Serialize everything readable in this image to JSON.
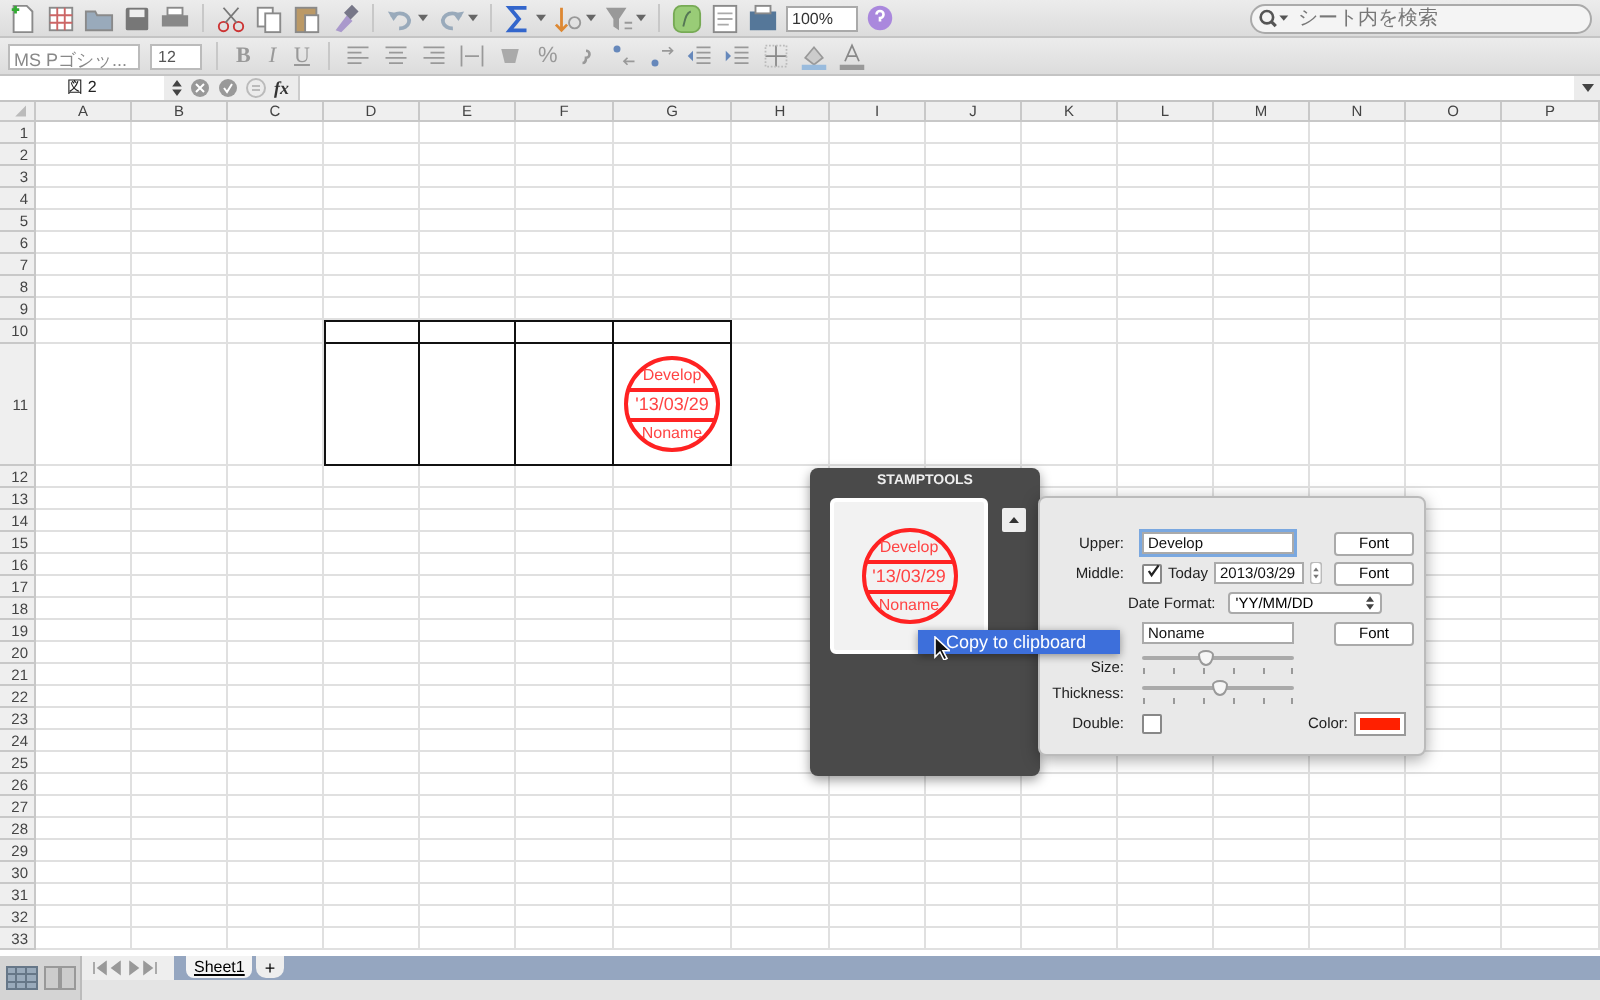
{
  "toolbar": {
    "zoom": "100%",
    "search_placeholder": "シート内を検索"
  },
  "format_bar": {
    "font": "MS Pゴシッ...",
    "size": "12",
    "style_buttons": [
      "B",
      "I",
      "U"
    ],
    "percent": "%"
  },
  "formula_bar": {
    "name_box": "図 2",
    "fx": "fx"
  },
  "sheet": {
    "columns": [
      "A",
      "B",
      "C",
      "D",
      "E",
      "F",
      "G",
      "H",
      "I",
      "J",
      "K",
      "L",
      "M",
      "N",
      "O",
      "P"
    ],
    "rows": [
      "1",
      "2",
      "3",
      "4",
      "5",
      "6",
      "7",
      "8",
      "9",
      "10",
      "11",
      "12",
      "13",
      "14",
      "15",
      "16",
      "17",
      "18",
      "19",
      "20",
      "21",
      "22",
      "23",
      "24",
      "25",
      "26",
      "27",
      "28",
      "29",
      "30",
      "31",
      "32",
      "33"
    ],
    "stamp": {
      "upper": "Develop",
      "middle": "'13/03/29",
      "lower": "Noname"
    }
  },
  "stamptools": {
    "title": "STAMPTOOLS",
    "preview": {
      "upper": "Develop",
      "middle": "'13/03/29",
      "lower": "Noname"
    },
    "context_menu": [
      {
        "label": "Copy to clipboard",
        "selected": true
      }
    ]
  },
  "properties": {
    "upper_label": "Upper:",
    "upper_value": "Develop",
    "middle_label": "Middle:",
    "today_checked": true,
    "today_label": "Today",
    "date_value": "2013/03/29",
    "date_format_label": "Date Format:",
    "date_format_value": "'YY/MM/DD",
    "lower_value": "Noname",
    "font_buttons": [
      "Font",
      "Font",
      "Font"
    ],
    "size_label": "Size:",
    "size_slider": {
      "level": 0.42
    },
    "thickness_label": "Thickness:",
    "thickness_slider": {
      "level": 0.51
    },
    "double_label": "Double:",
    "double_checked": false,
    "color_label": "Color:",
    "color": "#ff2000"
  },
  "sheet_tabs": [
    {
      "label": "Sheet1",
      "selected": true
    }
  ],
  "add_sheet": "+"
}
